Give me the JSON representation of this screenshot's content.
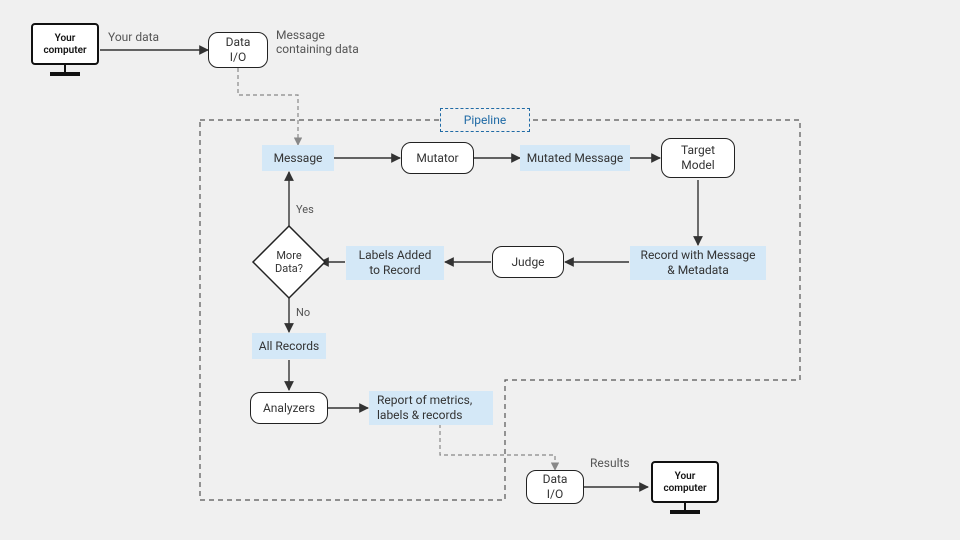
{
  "nodes": {
    "your_computer_1": "Your\ncomputer",
    "data_io_1": "Data\nI/O",
    "message": "Message",
    "mutator": "Mutator",
    "mutated_message": "Mutated Message",
    "target_model": "Target\nModel",
    "record_meta": "Record with Message\n& Metadata",
    "judge": "Judge",
    "labels_added": "Labels Added\nto Record",
    "more_data": "More\nData?",
    "all_records": "All Records",
    "analyzers": "Analyzers",
    "report": "Report of metrics,\nlabels & records",
    "data_io_2": "Data\nI/O",
    "your_computer_2": "Your\ncomputer",
    "pipeline": "Pipeline"
  },
  "labels": {
    "your_data": "Your data",
    "msg_containing": "Message\ncontaining data",
    "results": "Results",
    "yes": "Yes",
    "no": "No"
  }
}
